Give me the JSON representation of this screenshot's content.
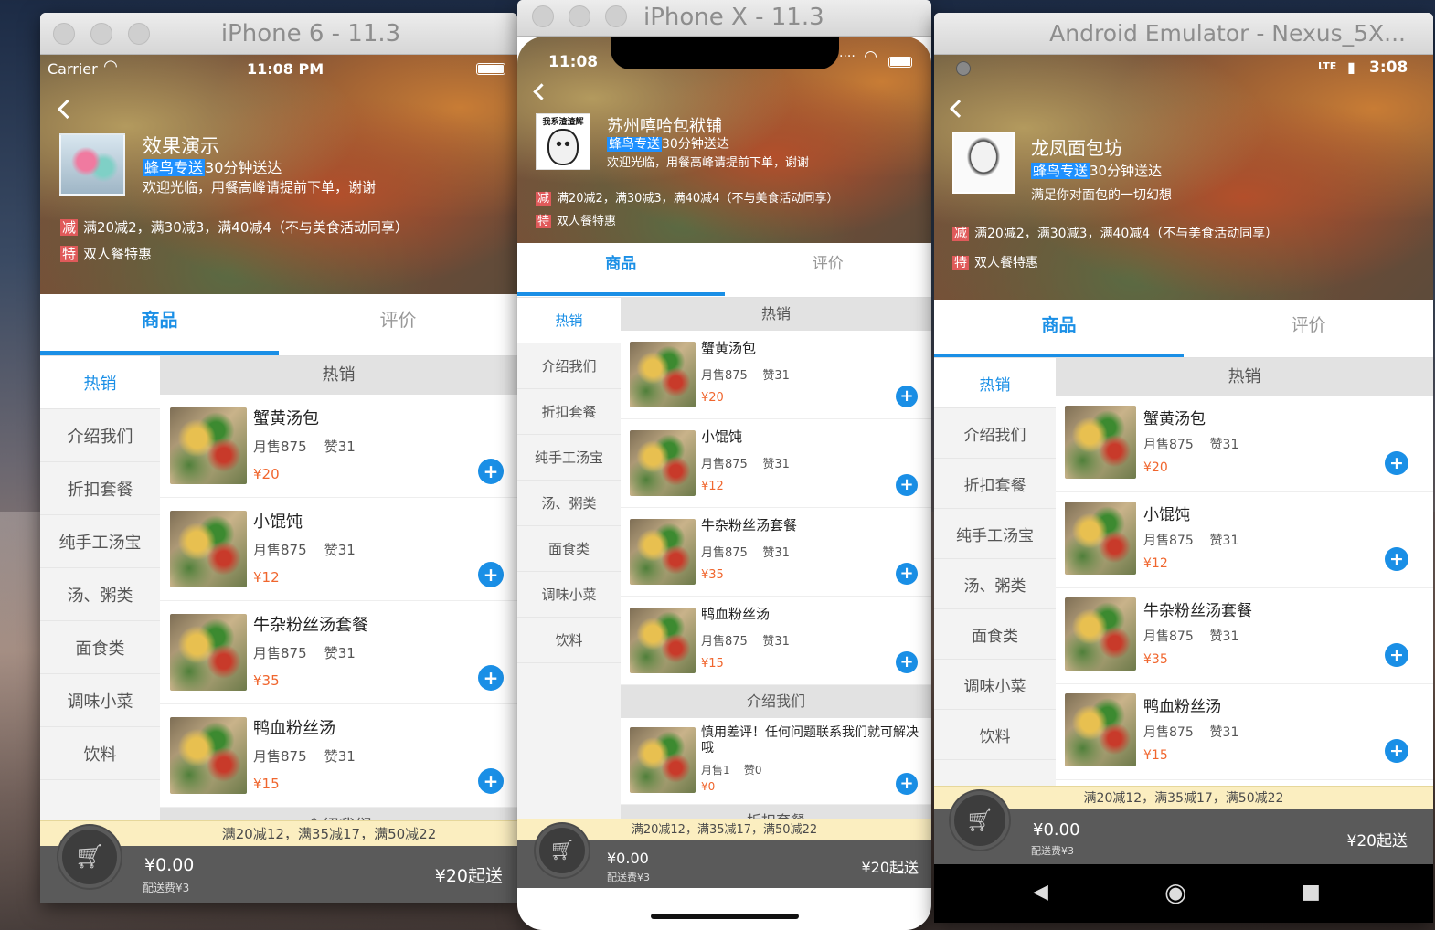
{
  "w1": {
    "title": "iPhone 6 - 11.3",
    "carrier": "Carrier",
    "time": "11:08 PM"
  },
  "w2": {
    "title": "iPhone X - 11.3",
    "time": "11:08"
  },
  "w3": {
    "title": "Android Emulator - Nexus_5X...",
    "time": "3:08",
    "net": "LTE"
  },
  "shop1": {
    "name": "效果演示",
    "tag": "蜂鸟专送",
    "deliver": "30分钟送达",
    "desc": "欢迎光临，用餐高峰请提前下单，谢谢"
  },
  "shop2": {
    "name": "苏州嘻哈包袱铺",
    "tag": "蜂鸟专送",
    "deliver": "30分钟送达",
    "desc": "欢迎光临，用餐高峰请提前下单，谢谢",
    "logo_text": "我系渣渣辉"
  },
  "shop3": {
    "name": "龙凤面包坊",
    "tag": "蜂鸟专送",
    "deliver": "30分钟送达",
    "desc": "满足你对面包的一切幻想"
  },
  "acts": {
    "jian_icon": "减",
    "jian": "满20减2，满30减3，满40减4（不与美食活动同享）",
    "te_icon": "特",
    "te": "双人餐特惠"
  },
  "tabs": {
    "goods": "商品",
    "reviews": "评价"
  },
  "menu": [
    "热销",
    "介绍我们",
    "折扣套餐",
    "纯手工汤宝",
    "汤、粥类",
    "面食类",
    "调味小菜",
    "饮料"
  ],
  "sections": {
    "hot": "热销",
    "about": "介绍我们",
    "discount": "折扣套餐"
  },
  "foods": [
    {
      "name": "蟹黄汤包",
      "sales": "月售875",
      "likes": "赞31",
      "price": "¥20"
    },
    {
      "name": "小馄饨",
      "sales": "月售875",
      "likes": "赞31",
      "price": "¥12"
    },
    {
      "name": "牛杂粉丝汤套餐",
      "sales": "月售875",
      "likes": "赞31",
      "price": "¥35"
    },
    {
      "name": "鸭血粉丝汤",
      "sales": "月售875",
      "likes": "赞31",
      "price": "¥15"
    }
  ],
  "about_item": {
    "name": "慎用差评！任何问题联系我们就可解决哦",
    "sales": "月售1",
    "likes": "赞0",
    "price": "¥0"
  },
  "add_icon": "+",
  "promo": "满20减12，满35减17，满50减22",
  "promo_x": "满20减12，满35减17，满50减22",
  "cart": {
    "total": "¥0.00",
    "fee": "配送费¥3",
    "min": "¥20起送",
    "icon": "shopping-cart-icon"
  },
  "android_nav": {
    "back": "◀",
    "home": "◉",
    "recent": "■"
  }
}
